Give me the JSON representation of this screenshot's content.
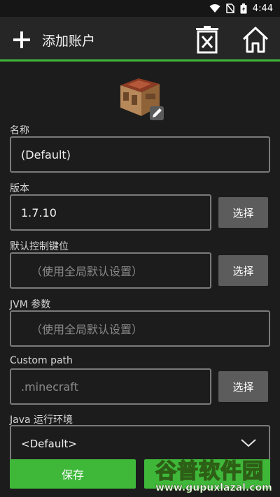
{
  "status_bar": {
    "time": "4:44"
  },
  "app_bar": {
    "title": "添加账户"
  },
  "form": {
    "name": {
      "label": "名称",
      "value": "(Default)"
    },
    "version": {
      "label": "版本",
      "value": "1.7.10",
      "button": "选择"
    },
    "controls": {
      "label": "默认控制键位",
      "placeholder": "（使用全局默认设置）",
      "button": "选择"
    },
    "jvm": {
      "label": "JVM 参数",
      "placeholder": "（使用全局默认设置）"
    },
    "custom_path": {
      "label": "Custom path",
      "placeholder": ".minecraft",
      "button": "选择"
    },
    "java": {
      "label": "Java 运行环境",
      "value": "<Default>"
    }
  },
  "save_label": "保存",
  "watermark": {
    "brand": "谷普软件园",
    "url": "www.gupuxlazal.com"
  },
  "colors": {
    "accent": "#3fb83a",
    "button_gray": "#5c5c5c"
  }
}
